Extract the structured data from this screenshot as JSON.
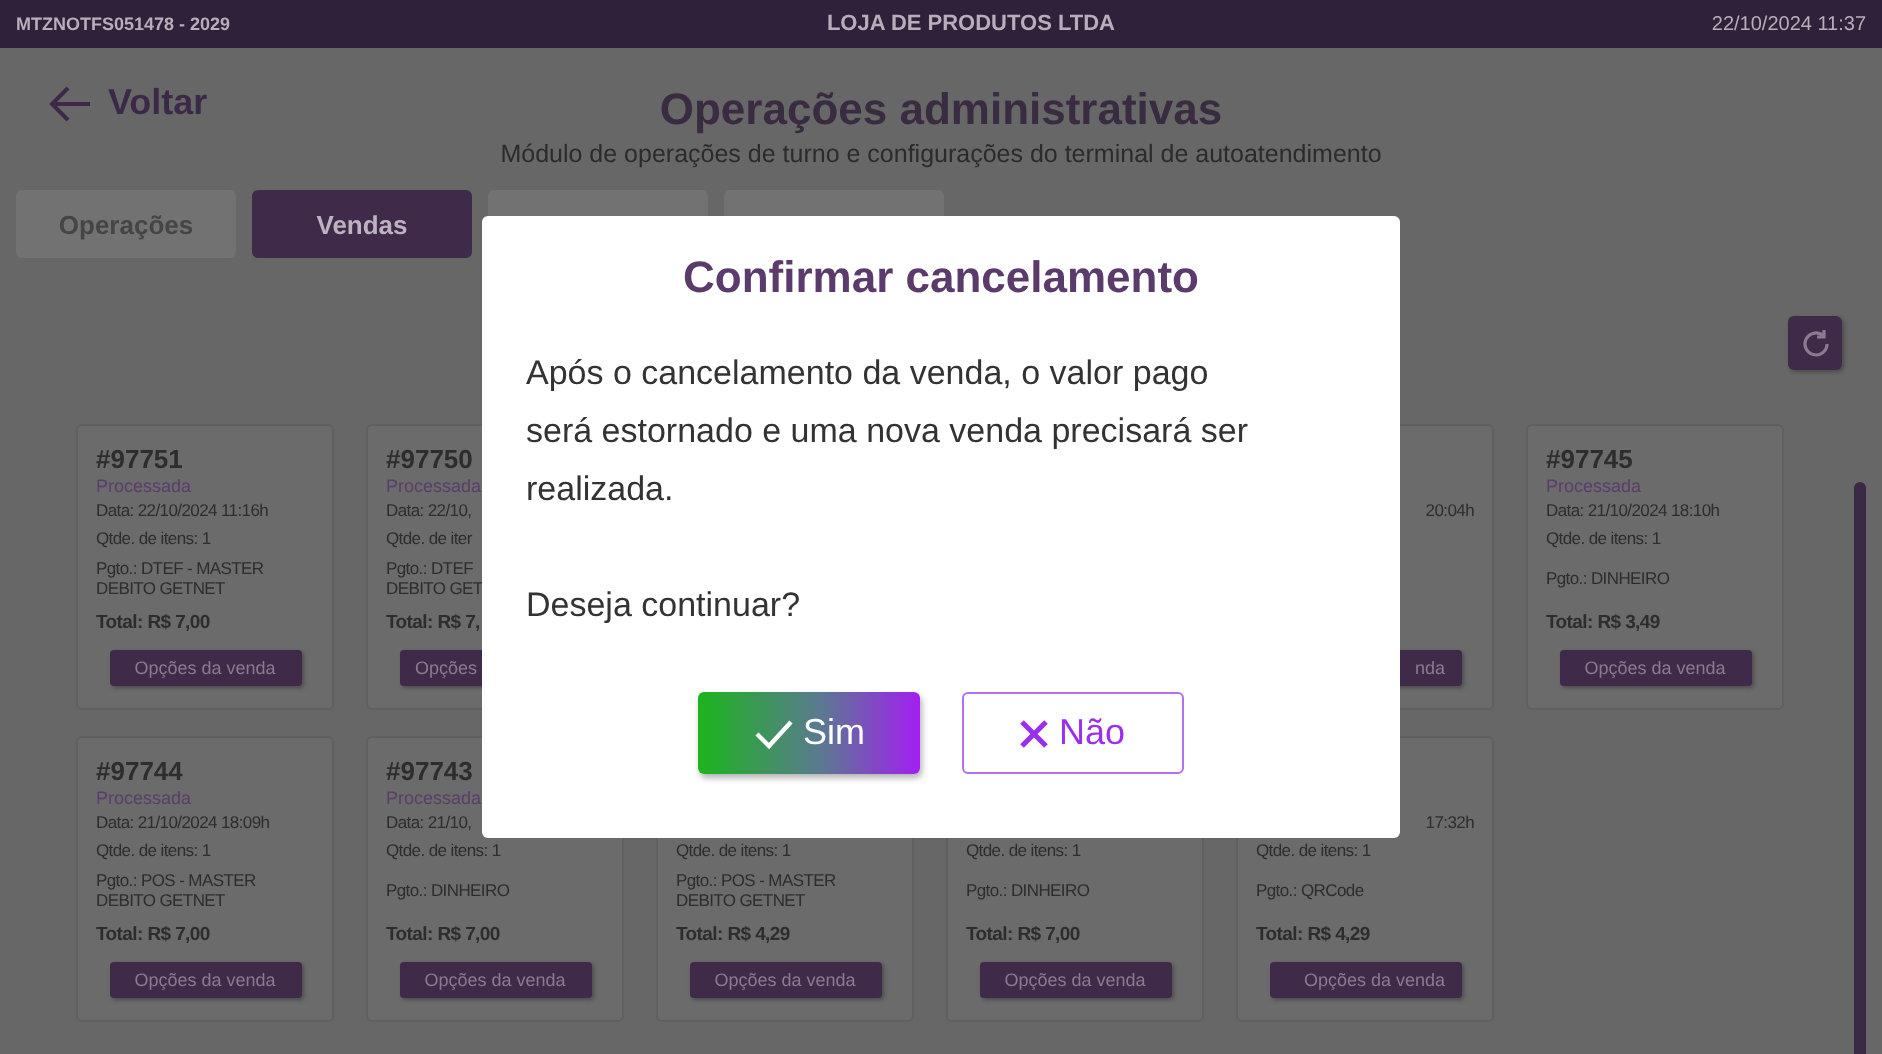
{
  "top_bar": {
    "terminal": "MTZNOTFS051478 - 2029",
    "store": "LOJA DE PRODUTOS LTDA",
    "datetime": "22/10/2024 11:37"
  },
  "header": {
    "back": "Voltar",
    "title": "Operações administrativas",
    "subtitle": "Módulo de operações de turno e configurações do terminal de autoatendimento"
  },
  "tabs": [
    {
      "label": "Operações",
      "selected": false
    },
    {
      "label": "Vendas",
      "selected": true
    },
    {
      "selected": false
    },
    {
      "selected": false
    }
  ],
  "sales": [
    {
      "kind": "card",
      "number": "#97751",
      "status": "Processada",
      "date": "Data: 22/10/2024 11:16h",
      "items": "Qtde. de itens: 1",
      "payment": [
        "Pgto.: DTEF - MASTER",
        "DEBITO GETNET"
      ],
      "total": "Total: R$ 7,00",
      "button": "Opções da venda",
      "cut_left": false,
      "cut_right": false
    },
    {
      "kind": "card",
      "number": "#97750",
      "status": "Processada",
      "date": "Data: 22/10,",
      "items": "Qtde. de iter",
      "payment": [
        "Pgto.: DTEF",
        "DEBITO GET"
      ],
      "total": "Total: R$ 7,",
      "button": "Opções",
      "cut_left": false,
      "cut_right": true
    },
    {
      "kind": "covered"
    },
    {
      "kind": "covered"
    },
    {
      "kind": "card",
      "date": "20:04h",
      "button": "nda",
      "cut_left": true,
      "cut_right": false
    },
    {
      "kind": "card",
      "number": "#97745",
      "status": "Processada",
      "date": "Data: 21/10/2024 18:10h",
      "items": "Qtde. de itens: 1",
      "payment": [
        "Pgto.: DINHEIRO"
      ],
      "total": "Total: R$ 3,49",
      "button": "Opções da venda",
      "cut_left": false,
      "cut_right": false
    },
    {
      "kind": "card",
      "number": "#97744",
      "status": "Processada",
      "date": "Data: 21/10/2024 18:09h",
      "items": "Qtde. de itens: 1",
      "payment": [
        "Pgto.: POS - MASTER",
        "DEBITO GETNET"
      ],
      "total": "Total: R$ 7,00",
      "button": "Opções da venda",
      "cut_left": false,
      "cut_right": false
    },
    {
      "kind": "card",
      "number": "#97743",
      "status": "Processada",
      "date": "Data: 21/10,",
      "items": "Qtde. de itens: 1",
      "payment": [
        "Pgto.: DINHEIRO"
      ],
      "total": "Total: R$ 7,00",
      "button": "Opções da venda",
      "cut_left": false,
      "cut_right": false
    },
    {
      "kind": "card",
      "items": "Qtde. de itens: 1",
      "payment": [
        "Pgto.: POS - MASTER",
        "DEBITO GETNET"
      ],
      "total": "Total: R$ 4,29",
      "button": "Opções da venda",
      "cut_left": false,
      "cut_right": false
    },
    {
      "kind": "card",
      "items": "Qtde. de itens: 1",
      "payment": [
        "Pgto.: DINHEIRO"
      ],
      "total": "Total: R$ 7,00",
      "button": "Opções da venda",
      "cut_left": false,
      "cut_right": false
    },
    {
      "kind": "card",
      "date": "17:32h",
      "items": "Qtde. de itens: 1",
      "payment": [
        "Pgto.: QRCode"
      ],
      "total": "Total: R$ 4,29",
      "button": "Opções da venda",
      "cut_left": true,
      "cut_right": false
    }
  ],
  "dialog": {
    "title": "Confirmar cancelamento",
    "paragraphs": [
      "Após o cancelamento da venda, o valor pago será estornado e uma nova venda precisará ser realizada.",
      "Deseja continuar?"
    ],
    "buttons": [
      {
        "kind": "confirm",
        "label": "Sim"
      },
      {
        "kind": "cancel",
        "label": "Não"
      }
    ]
  }
}
